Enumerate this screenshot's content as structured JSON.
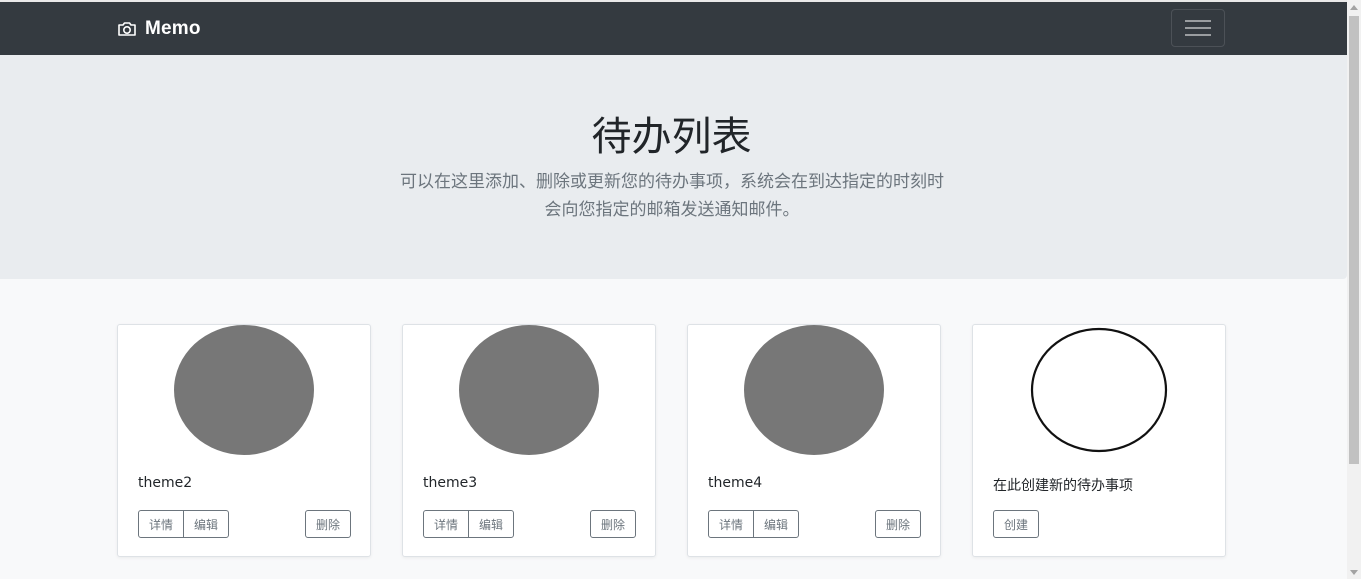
{
  "navbar": {
    "brand": "Memo",
    "brand_icon": "camera-icon",
    "toggler_icon": "hamburger-menu-icon"
  },
  "hero": {
    "title": "待办列表",
    "description_line1": "可以在这里添加、删除或更新您的待办事项，系统会在到达指定的时刻时",
    "description_line2": "会向您指定的邮箱发送通知邮件。"
  },
  "cards": [
    {
      "title": "theme2",
      "details_label": "详情",
      "edit_label": "编辑",
      "delete_label": "删除"
    },
    {
      "title": "theme3",
      "details_label": "详情",
      "edit_label": "编辑",
      "delete_label": "删除"
    },
    {
      "title": "theme4",
      "details_label": "详情",
      "edit_label": "编辑",
      "delete_label": "删除"
    }
  ],
  "create_card": {
    "title": "在此创建新的待办事项",
    "create_label": "创建"
  },
  "colors": {
    "navbar_bg": "#343a40",
    "hero_bg": "#e9ecef",
    "thumb_fill": "#777777",
    "button_border": "#6c757d"
  }
}
